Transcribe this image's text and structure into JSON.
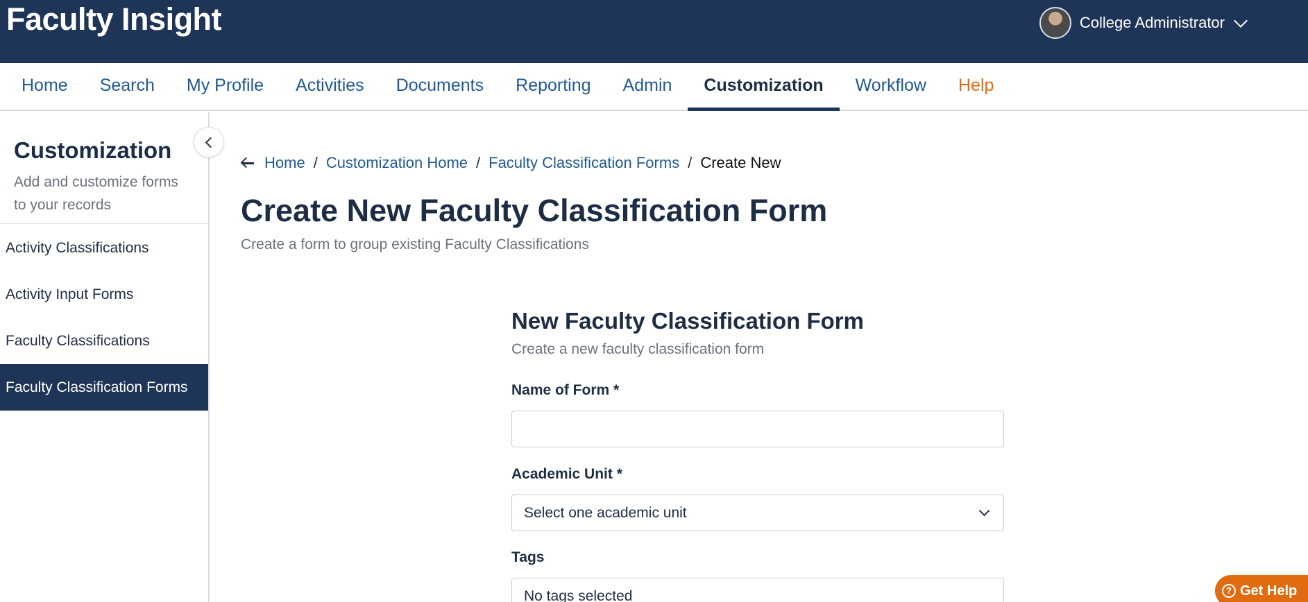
{
  "app": {
    "title": "Faculty Insight"
  },
  "user": {
    "name": "College Administrator"
  },
  "nav": {
    "items": [
      {
        "label": "Home"
      },
      {
        "label": "Search"
      },
      {
        "label": "My Profile"
      },
      {
        "label": "Activities"
      },
      {
        "label": "Documents"
      },
      {
        "label": "Reporting"
      },
      {
        "label": "Admin"
      },
      {
        "label": "Customization"
      },
      {
        "label": "Workflow"
      },
      {
        "label": "Help"
      }
    ],
    "active": "Customization"
  },
  "sidebar": {
    "title": "Customization",
    "subtitle": "Add and customize forms to your records",
    "items": [
      {
        "label": "Activity Classifications"
      },
      {
        "label": "Activity Input Forms"
      },
      {
        "label": "Faculty Classifications"
      },
      {
        "label": "Faculty Classification Forms"
      }
    ],
    "active": "Faculty Classification Forms"
  },
  "breadcrumb": {
    "items": [
      {
        "label": "Home"
      },
      {
        "label": "Customization Home"
      },
      {
        "label": "Faculty Classification Forms"
      }
    ],
    "current": "Create New",
    "separator": "/"
  },
  "page": {
    "title": "Create New Faculty Classification Form",
    "subtitle": "Create a form to group existing Faculty Classifications"
  },
  "form": {
    "title": "New Faculty Classification Form",
    "subtitle": "Create a new faculty classification form",
    "name_label": "Name of Form *",
    "name_value": "",
    "unit_label": "Academic Unit *",
    "unit_value": "Select one academic unit",
    "tags_label": "Tags",
    "tags_value": "No tags selected"
  },
  "help_button": {
    "label": "Get Help",
    "icon": "?"
  },
  "colors": {
    "header_bg": "#1f3557",
    "link": "#1f5a92",
    "accent_help": "#e06b10",
    "muted_text": "#6b7280"
  }
}
